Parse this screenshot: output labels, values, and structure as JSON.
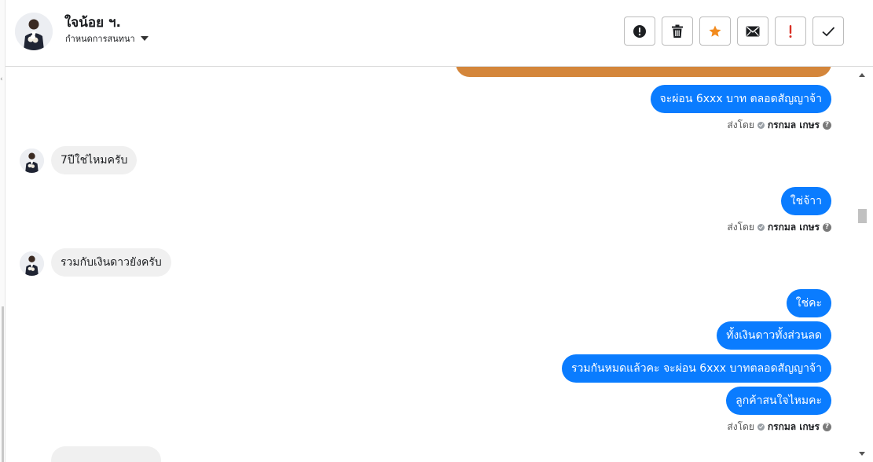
{
  "header": {
    "contact_name": "ใจน้อย ฯ.",
    "label_selector": "กำหนดการสนทนา",
    "actions": [
      {
        "name": "report-spam",
        "icon": "exclamation-circle-icon"
      },
      {
        "name": "delete",
        "icon": "trash-icon"
      },
      {
        "name": "star",
        "icon": "star-icon"
      },
      {
        "name": "mark-unread",
        "icon": "envelope-icon"
      },
      {
        "name": "mark-important",
        "icon": "exclamation-icon"
      },
      {
        "name": "mark-done",
        "icon": "check-icon"
      }
    ]
  },
  "colors": {
    "outgoing_bubble": "#0a7cff",
    "incoming_bubble": "#f0f0f0",
    "star": "#f28b1e",
    "important": "#d93025",
    "orange_bubble": "#d4863b"
  },
  "messages": {
    "m1": "จะผ่อน 6xxx บาท ตลอดสัญญาจ้า",
    "m2": "7ปีใช่ไหมครับ",
    "m3": "ใช่จ้าา",
    "m4": "รวมกับเงินดาวยังครับ",
    "m5": "ใช่คะ",
    "m6": "ทั้งเงินดาวทั้งส่วนลด",
    "m7": "รวมกันหมดแล้วคะ จะผ่อน 6xxx บาทตลอดสัญญาจ้า",
    "m8": "ลูกค้าสนใจไหมคะ"
  },
  "sent_by": {
    "prefix": "ส่งโดย",
    "name": "กรกมล เกษร",
    "help": "?"
  }
}
